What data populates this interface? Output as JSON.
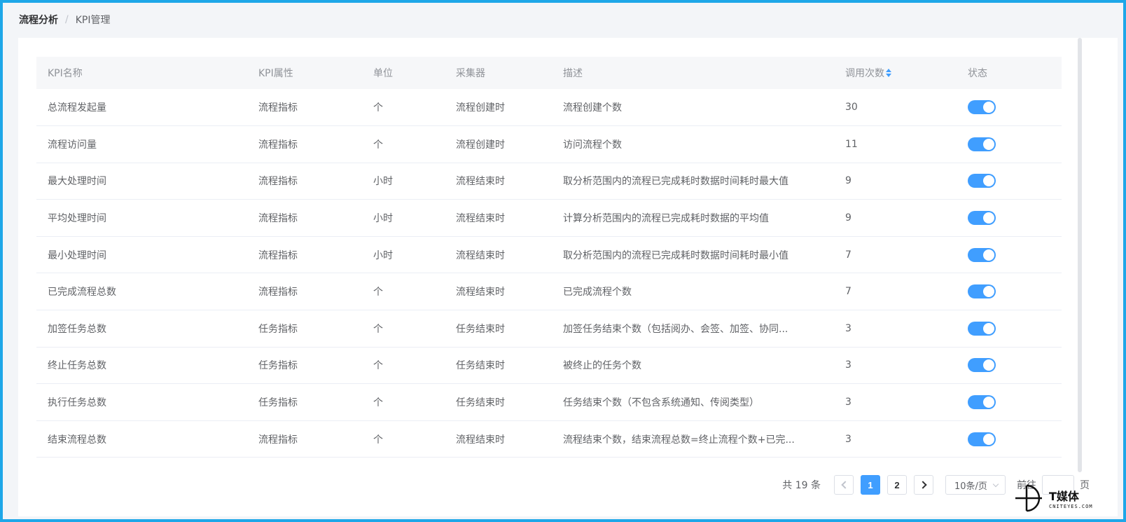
{
  "breadcrumb": {
    "first": "流程分析",
    "separator": "/",
    "current": "KPI管理"
  },
  "table": {
    "headers": {
      "name": "KPI名称",
      "attr": "KPI属性",
      "unit": "单位",
      "collector": "采集器",
      "desc": "描述",
      "calls": "调用次数",
      "status": "状态"
    },
    "rows": [
      {
        "name": "总流程发起量",
        "attr": "流程指标",
        "unit": "个",
        "collector": "流程创建时",
        "desc": "流程创建个数",
        "calls": "30",
        "enabled": true
      },
      {
        "name": "流程访问量",
        "attr": "流程指标",
        "unit": "个",
        "collector": "流程创建时",
        "desc": "访问流程个数",
        "calls": "11",
        "enabled": true
      },
      {
        "name": "最大处理时间",
        "attr": "流程指标",
        "unit": "小时",
        "collector": "流程结束时",
        "desc": "取分析范围内的流程已完成耗时数据时间耗时最大值",
        "calls": "9",
        "enabled": true
      },
      {
        "name": "平均处理时间",
        "attr": "流程指标",
        "unit": "小时",
        "collector": "流程结束时",
        "desc": "计算分析范围内的流程已完成耗时数据的平均值",
        "calls": "9",
        "enabled": true
      },
      {
        "name": "最小处理时间",
        "attr": "流程指标",
        "unit": "小时",
        "collector": "流程结束时",
        "desc": "取分析范围内的流程已完成耗时数据时间耗时最小值",
        "calls": "7",
        "enabled": true
      },
      {
        "name": "已完成流程总数",
        "attr": "流程指标",
        "unit": "个",
        "collector": "流程结束时",
        "desc": "已完成流程个数",
        "calls": "7",
        "enabled": true
      },
      {
        "name": "加签任务总数",
        "attr": "任务指标",
        "unit": "个",
        "collector": "任务结束时",
        "desc": "加签任务结束个数（包括阅办、会签、加签、协同...",
        "calls": "3",
        "enabled": true
      },
      {
        "name": "终止任务总数",
        "attr": "任务指标",
        "unit": "个",
        "collector": "任务结束时",
        "desc": "被终止的任务个数",
        "calls": "3",
        "enabled": true
      },
      {
        "name": "执行任务总数",
        "attr": "任务指标",
        "unit": "个",
        "collector": "任务结束时",
        "desc": "任务结束个数（不包含系统通知、传阅类型）",
        "calls": "3",
        "enabled": true
      },
      {
        "name": "结束流程总数",
        "attr": "流程指标",
        "unit": "个",
        "collector": "流程结束时",
        "desc": "流程结束个数，结束流程总数=终止流程个数+已完...",
        "calls": "3",
        "enabled": true
      }
    ]
  },
  "pagination": {
    "total_text": "共 19 条",
    "pages": [
      "1",
      "2"
    ],
    "current_page": "1",
    "page_size": "10条/页",
    "goto_label": "前往",
    "goto_suffix": "页"
  },
  "watermark": {
    "main": "T媒体",
    "sub": "CNITEYES.COM"
  },
  "colors": {
    "accent": "#409eff",
    "frame": "#1ea7e8"
  }
}
